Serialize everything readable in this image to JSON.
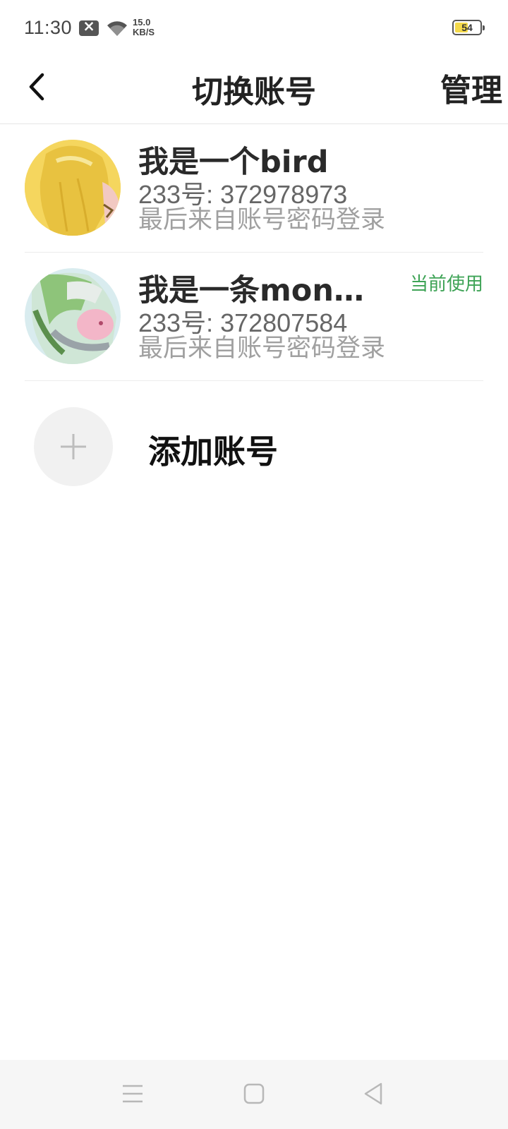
{
  "status_bar": {
    "time": "11:30",
    "net_speed_value": "15.0",
    "net_speed_unit": "KB/S",
    "battery_level": "54",
    "battery_fraction": 0.54,
    "battery_fill_color": "#f4d94a"
  },
  "header": {
    "title": "切换账号",
    "manage_label": "管理"
  },
  "accounts": [
    {
      "name": "我是一个bird",
      "id_text": "233号: 372978973",
      "login_method": "最后来自账号密码登录",
      "current": false
    },
    {
      "name": "我是一条monk...",
      "id_text": "233号: 372807584",
      "login_method": "最后来自账号密码登录",
      "current": true,
      "current_label": "当前使用"
    }
  ],
  "add_account": {
    "label": "添加账号"
  },
  "colors": {
    "accent_green": "#3ea356",
    "text_dark": "#2a2a2a",
    "text_gray": "#a0a0a0"
  },
  "icons": {
    "back": "back-arrow-icon",
    "add": "plus-icon",
    "nav_menu": "menu-icon",
    "nav_home": "home-square-icon",
    "nav_back": "back-triangle-icon"
  }
}
